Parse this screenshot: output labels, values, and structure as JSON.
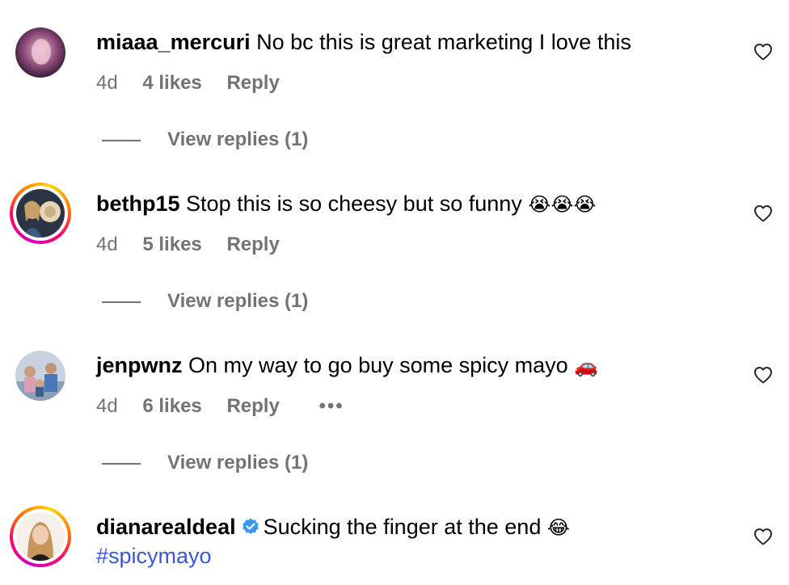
{
  "comments": [
    {
      "username": "miaaa_mercuri",
      "text": "No bc this is great marketing I love this",
      "age": "4d",
      "likes": "4 likes",
      "reply": "Reply",
      "view_replies": "View replies (1)",
      "avatar_ring": false,
      "avatar_colors": [
        "#2a1a2e",
        "#c8a0b8"
      ]
    },
    {
      "username": "bethp15",
      "text": "Stop this is so cheesy but so funny",
      "emoji": "😭😭😭",
      "age": "4d",
      "likes": "5 likes",
      "reply": "Reply",
      "view_replies": "View replies (1)",
      "avatar_ring": true,
      "avatar_colors": [
        "#1b2a3a",
        "#d9c7a8"
      ]
    },
    {
      "username": "jenpwnz",
      "text": "On my way to go buy some spicy mayo",
      "emoji": "🚗",
      "age": "4d",
      "likes": "6 likes",
      "reply": "Reply",
      "more": "•••",
      "view_replies": "View replies (1)",
      "avatar_ring": false,
      "avatar_colors": [
        "#b8c4d8",
        "#6a7f9a"
      ]
    },
    {
      "username": "dianarealdeal",
      "verified": true,
      "text": "Sucking the finger at the end",
      "emoji": "😂",
      "hashtag": "#spicymayo",
      "avatar_ring": true,
      "avatar_colors": [
        "#f2e8dc",
        "#c89a5c"
      ]
    }
  ],
  "colors": {
    "meta": "#737373",
    "hashtag": "#3a57d6",
    "verified": "#3897f0"
  },
  "icons": {
    "like": "heart-outline-icon",
    "verified": "verified-badge-icon"
  }
}
